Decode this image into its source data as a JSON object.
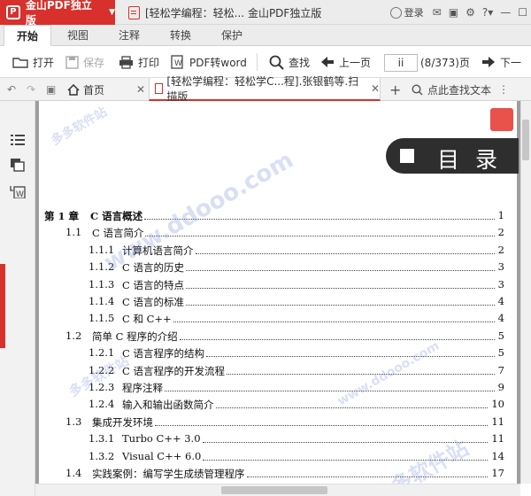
{
  "app": {
    "name": "金山PDF独立版",
    "window_title": "[轻松学编程：轻松... 金山PDF独立版",
    "login": "登录"
  },
  "ribbon_tabs": [
    "开始",
    "视图",
    "注释",
    "转换",
    "保护"
  ],
  "toolbar": {
    "open": "打开",
    "save": "保存",
    "print": "打印",
    "pdf_to_word": "PDF转word",
    "find": "查找",
    "prev_page": "上一页",
    "page_input": "ii",
    "page_count": "(8/373)页",
    "next_page": "下一"
  },
  "doc_tabs": {
    "home": "首页",
    "document": "[轻松学编程：轻松学C...程].张银鹤等.扫描版",
    "find_text": "点此查找文本"
  },
  "toc": {
    "heading": "目录",
    "entries": [
      {
        "num": "第 1 章",
        "title": "C 语言概述",
        "page": "1",
        "level": 0
      },
      {
        "num": "1.1",
        "title": "C 语言简介",
        "page": "2",
        "level": 1
      },
      {
        "num": "1.1.1",
        "title": "计算机语言简介",
        "page": "2",
        "level": 2
      },
      {
        "num": "1.1.2",
        "title": "C 语言的历史",
        "page": "3",
        "level": 2
      },
      {
        "num": "1.1.3",
        "title": "C 语言的特点",
        "page": "3",
        "level": 2
      },
      {
        "num": "1.1.4",
        "title": "C 语言的标准",
        "page": "4",
        "level": 2
      },
      {
        "num": "1.1.5",
        "title": "C 和 C++",
        "page": "4",
        "level": 2
      },
      {
        "num": "1.2",
        "title": "简单 C 程序的介绍",
        "page": "5",
        "level": 1
      },
      {
        "num": "1.2.1",
        "title": "C 语言程序的结构",
        "page": "5",
        "level": 2
      },
      {
        "num": "1.2.2",
        "title": "C 语言程序的开发流程",
        "page": "7",
        "level": 2
      },
      {
        "num": "1.2.3",
        "title": "程序注释",
        "page": "9",
        "level": 2
      },
      {
        "num": "1.2.4",
        "title": "输入和输出函数简介",
        "page": "10",
        "level": 2
      },
      {
        "num": "1.3",
        "title": "集成开发环境",
        "page": "11",
        "level": 1
      },
      {
        "num": "1.3.1",
        "title": "Turbo C++ 3.0",
        "page": "11",
        "level": 2
      },
      {
        "num": "1.3.2",
        "title": "Visual C++ 6.0",
        "page": "14",
        "level": 2
      },
      {
        "num": "1.4",
        "title": "实践案例：编写学生成绩管理程序",
        "page": "17",
        "level": 1
      }
    ]
  },
  "watermarks": [
    "多多软件站",
    "www.ddooo.com",
    "多多软件站",
    "www.ddooo.com",
    "多多软件站"
  ],
  "colors": {
    "accent": "#d8302c",
    "banner": "#2e2e2e",
    "watermark": "#8c9ee0"
  },
  "icons": [
    "pdf-logo-icon",
    "open-folder-icon",
    "save-icon",
    "print-icon",
    "pdf-to-word-icon",
    "search-icon",
    "left-arrow-icon",
    "right-arrow-icon",
    "home-icon",
    "bookmark-list-icon",
    "thumbnails-icon",
    "convert-icon"
  ]
}
